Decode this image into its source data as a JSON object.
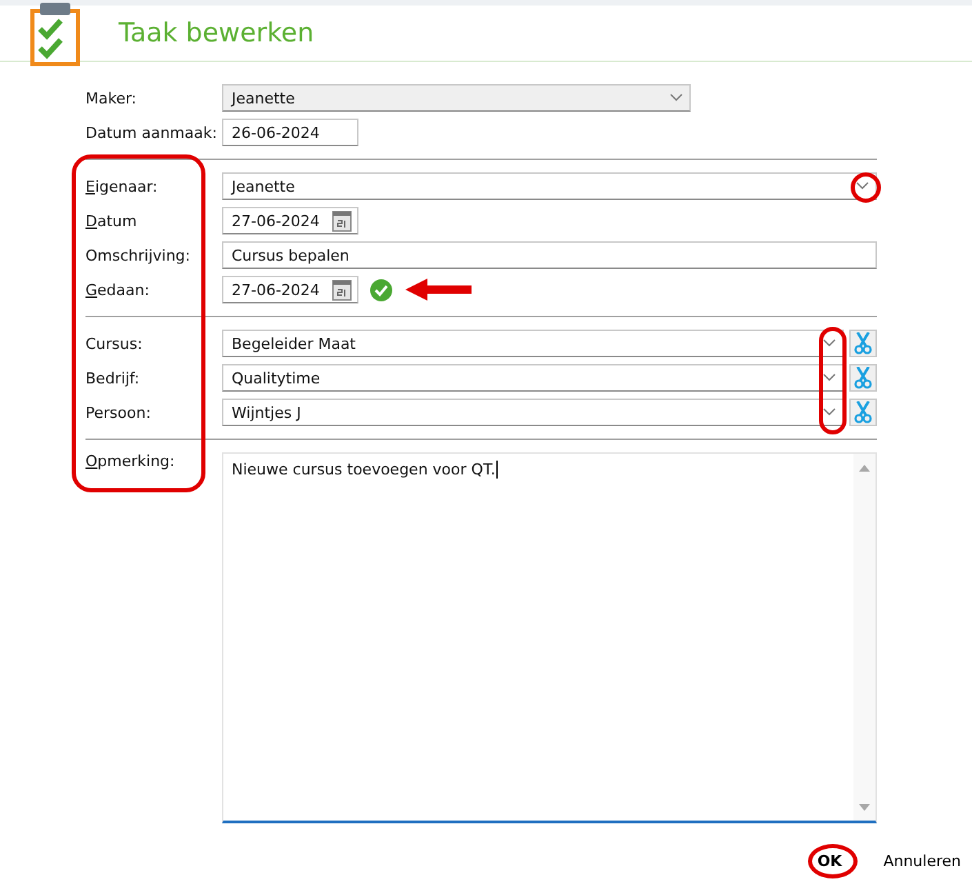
{
  "header": {
    "title": "Taak bewerken"
  },
  "form": {
    "labels_circled": true,
    "sections": [
      {
        "rows": [
          {
            "label": "Maker:",
            "mnemonic": false,
            "kind": "combo",
            "value": "Jeanette",
            "disabled": true,
            "chevron_circled": false
          },
          {
            "label": "Datum aanmaak:",
            "mnemonic": false,
            "kind": "short",
            "value": "26-06-2024"
          }
        ]
      },
      {
        "rows": [
          {
            "label": "Eigenaar:",
            "mnemonic": true,
            "kind": "combo",
            "value": "Jeanette",
            "disabled": false,
            "chevron_circled": true
          },
          {
            "label": "Datum",
            "mnemonic": true,
            "kind": "date",
            "value": "27-06-2024",
            "done": false,
            "arrow": false
          },
          {
            "label": "Omschrijving:",
            "mnemonic": false,
            "kind": "text",
            "value": "Cursus bepalen"
          },
          {
            "label": "Gedaan:",
            "mnemonic": true,
            "kind": "date",
            "value": "27-06-2024",
            "done": true,
            "arrow": true
          }
        ]
      },
      {
        "chevrons_circled": true,
        "rows": [
          {
            "label": "Cursus:",
            "mnemonic": false,
            "kind": "lookup",
            "value": "Begeleider Maat"
          },
          {
            "label": "Bedrijf:",
            "mnemonic": false,
            "kind": "lookup",
            "value": "Qualitytime"
          },
          {
            "label": "Persoon:",
            "mnemonic": false,
            "kind": "lookup",
            "value": "Wijntjes J"
          }
        ]
      }
    ],
    "remarks": {
      "label": "Opmerking:",
      "mnemonic": true,
      "value": "Nieuwe cursus toevoegen voor QT.",
      "focused": true
    }
  },
  "footer": {
    "ok": {
      "label": "OK",
      "circled": true
    },
    "cancel": {
      "label": "Annuleren"
    }
  }
}
